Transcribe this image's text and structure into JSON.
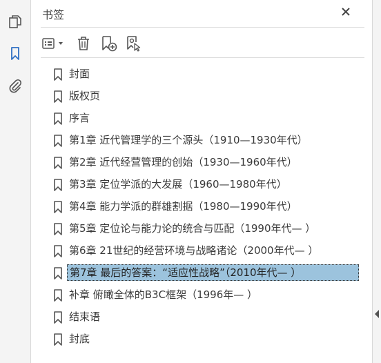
{
  "panel": {
    "title": "书签"
  },
  "left_rail": {
    "icons": [
      "pages-icon",
      "bookmarks-icon",
      "attachments-icon"
    ],
    "active": "bookmarks-icon"
  },
  "toolbar": {
    "icons": [
      "options-menu-icon",
      "delete-bookmark-icon",
      "new-bookmark-icon",
      "bookmark-from-selection-icon"
    ]
  },
  "bookmarks": [
    {
      "label": "封面"
    },
    {
      "label": "版权页"
    },
    {
      "label": "序言"
    },
    {
      "label": "第1章 近代管理学的三个源头（1910—1930年代）"
    },
    {
      "label": "第2章 近代经营管理的创始（1930—1960年代）"
    },
    {
      "label": "第3章 定位学派的大发展（1960—1980年代）"
    },
    {
      "label": "第4章 能力学派的群雄割据（1980—1990年代）"
    },
    {
      "label": "第5章 定位论与能力论的统合与匹配（1990年代— ）"
    },
    {
      "label": "第6章 21世纪的经营环境与战略诸论（2000年代— ）"
    },
    {
      "label": "第7章 最后的答案：“适应性战略”（2010年代— ）",
      "selected": true
    },
    {
      "label": "补章 俯瞰全体的B3C框架（1996年— ）"
    },
    {
      "label": "结束语"
    },
    {
      "label": "封底"
    }
  ],
  "colors": {
    "accent": "#2f6fc4",
    "selection": "#9cc3dd",
    "icon": "#555555"
  }
}
